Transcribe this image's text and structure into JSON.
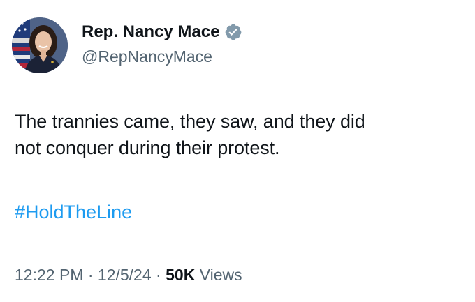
{
  "author": {
    "name": "Rep. Nancy Mace",
    "handle": "@RepNancyMace",
    "verified_icon": "verified-badge",
    "verified_color": "#829aab"
  },
  "post": {
    "lines": [
      "The trannies came, they saw, and they did",
      "not conquer during their protest."
    ],
    "hashtag": "#HoldTheLine"
  },
  "meta": {
    "time": "12:22 PM",
    "separator": " · ",
    "date": "12/5/24",
    "views_count": "50K",
    "views_label": "Views"
  },
  "colors": {
    "link": "#1d9bf0",
    "secondary_text": "#536471",
    "primary_text": "#0f1419"
  }
}
